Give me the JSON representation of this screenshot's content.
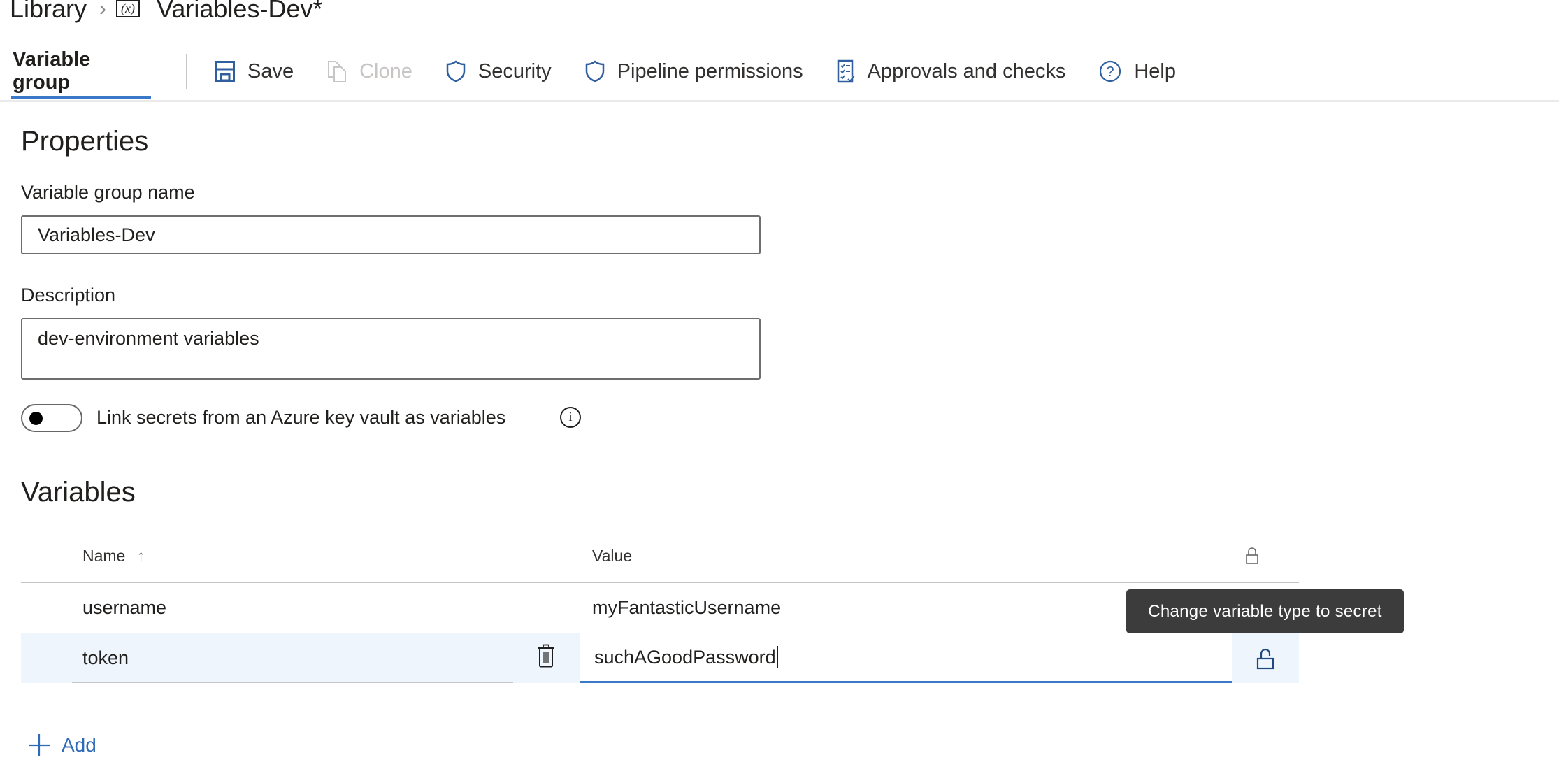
{
  "breadcrumb": {
    "root": "Library",
    "separator": ">",
    "icon": "variable-group-icon",
    "icon_text": "(x)",
    "current": "Variables-Dev*"
  },
  "toolbar": {
    "active_tab": "Variable group",
    "buttons": [
      {
        "label": "Save",
        "icon": "save-icon",
        "disabled": false
      },
      {
        "label": "Clone",
        "icon": "clone-icon",
        "disabled": true
      },
      {
        "label": "Security",
        "icon": "shield-icon",
        "disabled": false
      },
      {
        "label": "Pipeline permissions",
        "icon": "shield-icon",
        "disabled": false
      },
      {
        "label": "Approvals and checks",
        "icon": "checklist-icon",
        "disabled": false
      },
      {
        "label": "Help",
        "icon": "help-icon",
        "disabled": false
      }
    ]
  },
  "properties": {
    "heading": "Properties",
    "name_label": "Variable group name",
    "name_value": "Variables-Dev",
    "description_label": "Description",
    "description_value": "dev-environment variables",
    "keyvault_toggle_label": "Link secrets from an Azure key vault as variables",
    "keyvault_toggle_on": false,
    "info_icon_text": "i"
  },
  "variables": {
    "heading": "Variables",
    "columns": {
      "name": "Name",
      "name_sort": "↑",
      "value": "Value",
      "secret": "lock-icon"
    },
    "rows": [
      {
        "name": "username",
        "value": "myFantasticUsername",
        "secret": false,
        "editing": false
      },
      {
        "name": "token",
        "value": "suchAGoodPassword",
        "secret": false,
        "editing": true
      }
    ],
    "tooltip": "Change variable type to secret",
    "add_label": "Add"
  },
  "colors": {
    "accent": "#3a78c8",
    "icon_blue": "#2f5f9e",
    "row_highlight": "#eff5fc",
    "tooltip_bg": "#3c3c3c"
  }
}
